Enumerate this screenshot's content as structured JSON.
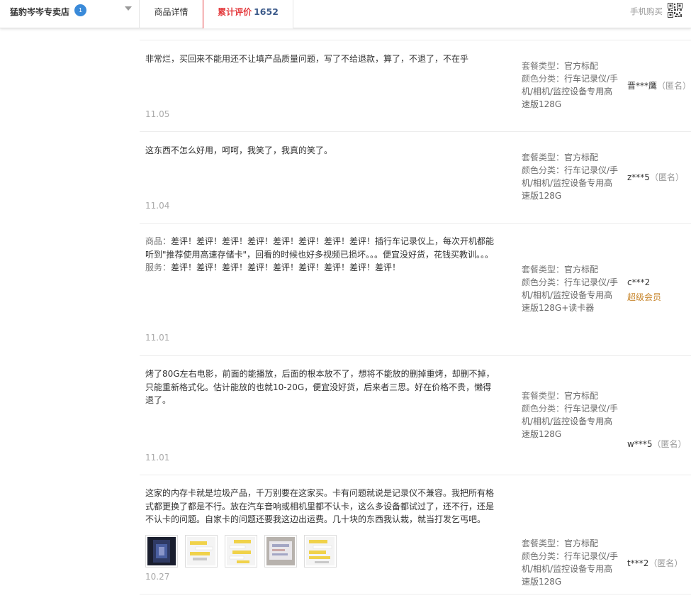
{
  "header": {
    "shop_name": "猛豹岑岑专卖店",
    "shop_badge": "1",
    "tab_detail": "商品详情",
    "tab_reviews": "累计评价",
    "review_count": "1652",
    "mobile_buy": "手机购买"
  },
  "meta_labels": {
    "package": "套餐类型：",
    "color": "颜色分类："
  },
  "reviews": [
    {
      "text": "非常烂，买回来不能用还不让填产品质量问题，写了不给退款，算了，不退了，不在乎",
      "date": "11.05",
      "package": "官方标配",
      "color": "行车记录仪/手机/相机/监控设备专用高速版128G",
      "user": "晋***鹰",
      "anon": "（匿名）"
    },
    {
      "text": "这东西不怎么好用，呵呵，我笑了，我真的笑了。",
      "date": "11.04",
      "package": "官方标配",
      "color": "行车记录仪/手机/相机/监控设备专用高速版128G",
      "user": "z***5",
      "anon": "（匿名）"
    },
    {
      "product_label": "商品：",
      "product_text": "差评！差评！差评！差评！差评！差评！差评！差评！插行车记录仪上，每次开机都能听到\"推荐使用高速存储卡\"，回看的时候也好多视频已损坏。。。便宜没好货，花钱买教训。。。",
      "service_label": "服务：",
      "service_text": "差评！差评！差评！差评！差评！差评！差评！差评！差评！",
      "date": "11.01",
      "package": "官方标配",
      "color": "行车记录仪/手机/相机/监控设备专用高速版128G+读卡器",
      "user": "c***2",
      "vip": "超级会员"
    },
    {
      "text": "烤了80G左右电影，前面的能播放，后面的根本放不了，想将不能放的删掉重烤，却删不掉，只能重新格式化。估计能放的也就10-20G，便宜没好货，后来者三思。好在价格不贵，懒得退了。",
      "date": "11.01",
      "package": "官方标配",
      "color": "行车记录仪/手机/相机/监控设备专用高速版128G",
      "user": "w***5",
      "anon": "（匿名）"
    },
    {
      "text": "这家的内存卡就是垃圾产品，千万别要在这家买。卡有问题就说是记录仪不兼容。我把所有格式都更换了都是不行。放在汽车音响或相机里都不认卡，这么多设备都试过了，还不行，还是不认卡的问题。自家卡的问题还要我这边出运费。几十块的东西我认栽，就当打发乞丐吧。",
      "date": "10.27",
      "package": "官方标配",
      "color": "行车记录仪/手机/相机/监控设备专用高速版128G",
      "user": "t***2",
      "anon": "（匿名）",
      "photos": [
        "review-photo-1",
        "review-photo-2",
        "review-photo-3",
        "review-photo-4",
        "review-photo-5"
      ]
    }
  ]
}
